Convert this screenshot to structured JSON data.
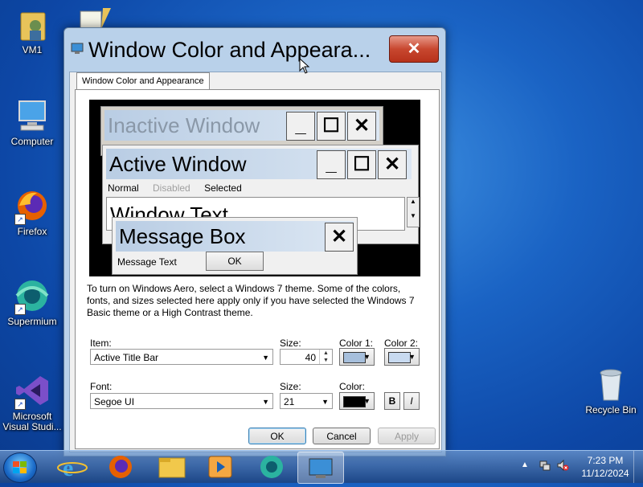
{
  "desktop": {
    "icons": [
      {
        "label": "VM1"
      },
      {
        "label": "Computer"
      },
      {
        "label": "Firefox"
      },
      {
        "label": "Supermium"
      },
      {
        "label": "Microsoft Visual Studi..."
      },
      {
        "label": "Recycle Bin"
      }
    ]
  },
  "dialog": {
    "title": "Window Color and Appeara...",
    "close_glyph": "✕",
    "tab_label": "Window Color and Appearance",
    "preview": {
      "inactive_title": "Inactive Window",
      "active_title": "Active Window",
      "menu_normal": "Normal",
      "menu_disabled": "Disabled",
      "menu_selected": "Selected",
      "window_text": "Window Text",
      "msgbox_title": "Message Box",
      "msgbox_text": "Message Text",
      "msgbox_ok": "OK",
      "min_glyph": "_",
      "max_glyph": "☐",
      "close_glyph": "✕"
    },
    "info_text": "To turn on Windows Aero, select a Windows 7 theme.  Some of the colors, fonts, and sizes selected here apply only if you have selected the Windows 7 Basic theme or a High Contrast theme.",
    "item_label": "Item:",
    "item_value": "Active Title Bar",
    "size_label": "Size:",
    "size_value": "40",
    "color1_label": "Color 1:",
    "color2_label": "Color 2:",
    "color1": "#a6bfdc",
    "color2": "#c8daf0",
    "font_label": "Font:",
    "font_value": "Segoe UI",
    "font_size_label": "Size:",
    "font_size_value": "21",
    "font_color_label": "Color:",
    "font_color": "#000000",
    "bold_label": "B",
    "italic_label": "I",
    "ok_label": "OK",
    "cancel_label": "Cancel",
    "apply_label": "Apply"
  },
  "tray": {
    "time": "7:23 PM",
    "date": "11/12/2024"
  }
}
